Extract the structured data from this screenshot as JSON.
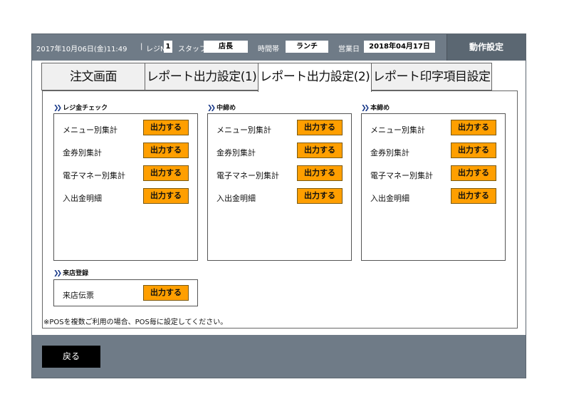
{
  "header": {
    "datetime": "2017年10月06日(金)11:49",
    "register_label": "レジNo",
    "register_no": "1",
    "staff_label": "スタッフ",
    "staff_value": "店長",
    "timeslot_label": "時間帯",
    "timeslot_value": "ランチ",
    "business_day_label": "営業日",
    "business_day_value": "2018年04月17日",
    "action_settings": "動作設定"
  },
  "tabs": [
    {
      "label": "注文画面",
      "active": false
    },
    {
      "label": "レポート出力設定(1)",
      "active": false
    },
    {
      "label": "レポート出力設定(2)",
      "active": true
    },
    {
      "label": "レポート印字項目設定",
      "active": false
    }
  ],
  "sections": [
    {
      "title": "レジ金チェック",
      "rows": [
        {
          "label": "メニュー別集計",
          "button": "出力する"
        },
        {
          "label": "金券別集計",
          "button": "出力する"
        },
        {
          "label": "電子マネー別集計",
          "button": "出力する"
        },
        {
          "label": "入出金明細",
          "button": "出力する"
        }
      ]
    },
    {
      "title": "中締め",
      "rows": [
        {
          "label": "メニュー別集計",
          "button": "出力する"
        },
        {
          "label": "金券別集計",
          "button": "出力する"
        },
        {
          "label": "電子マネー別集計",
          "button": "出力する"
        },
        {
          "label": "入出金明細",
          "button": "出力する"
        }
      ]
    },
    {
      "title": "本締め",
      "rows": [
        {
          "label": "メニュー別集計",
          "button": "出力する"
        },
        {
          "label": "金券別集計",
          "button": "出力する"
        },
        {
          "label": "電子マネー別集計",
          "button": "出力する"
        },
        {
          "label": "入出金明細",
          "button": "出力する"
        }
      ]
    }
  ],
  "visit": {
    "title": "来店登録",
    "rows": [
      {
        "label": "来店伝票",
        "button": "出力する"
      }
    ]
  },
  "note": "※POSを複数ご利用の場合、POS毎に設定してください。",
  "footer": {
    "back_label": "戻る"
  },
  "colors": {
    "header_bg": "#6f7b87",
    "output_button": "#ff9f00",
    "back_button": "#000000"
  }
}
